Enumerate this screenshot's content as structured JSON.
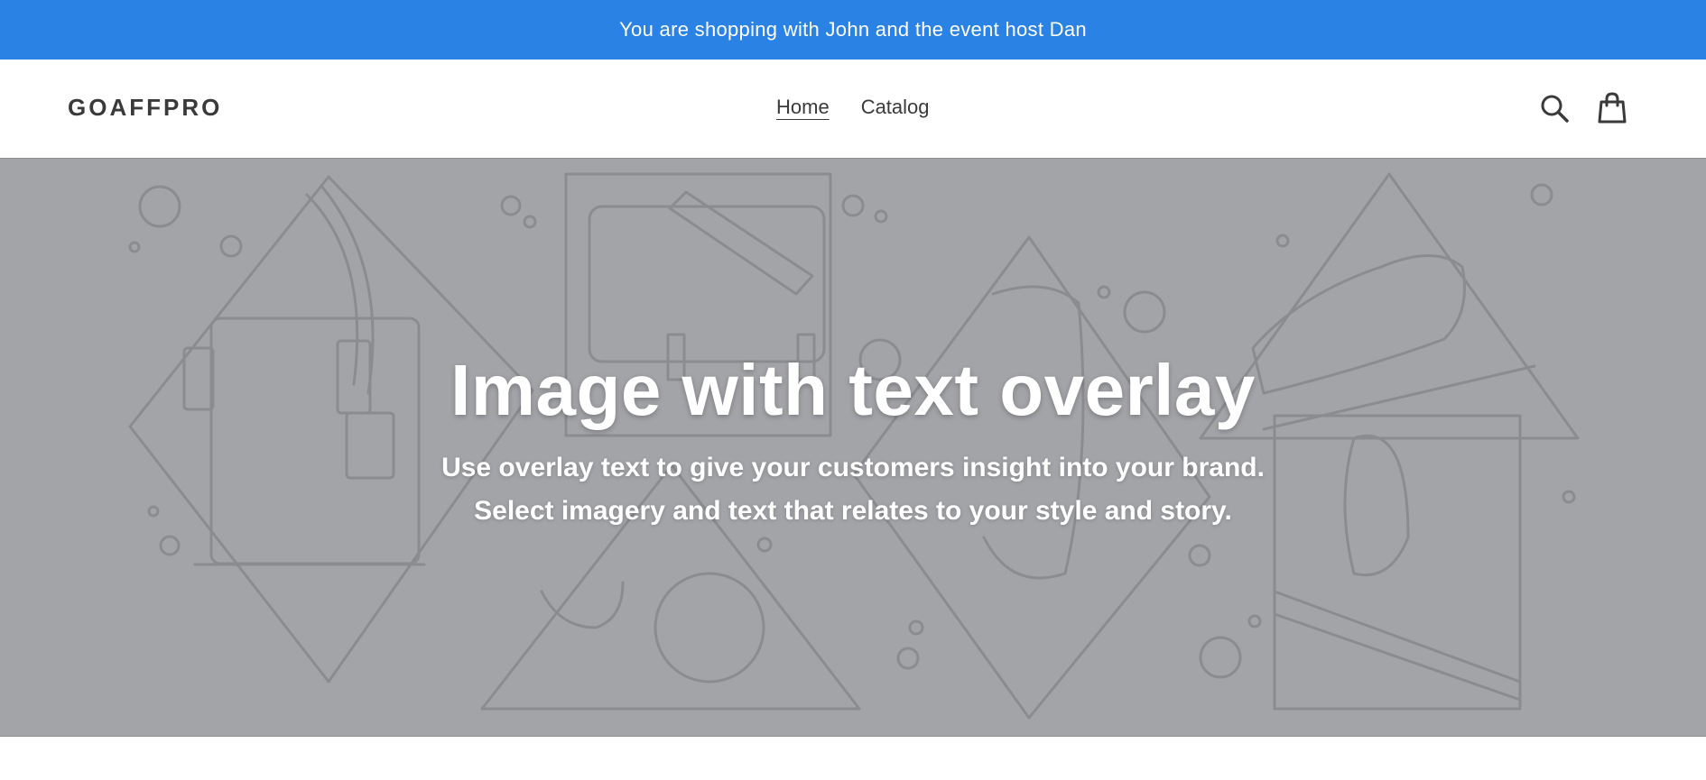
{
  "announcement": {
    "text": "You are shopping with John and the event host Dan",
    "background": "#2a82e4"
  },
  "header": {
    "logo": "GOAFFPRO",
    "nav": [
      {
        "label": "Home",
        "active": true
      },
      {
        "label": "Catalog",
        "active": false
      }
    ],
    "icons": [
      "search-icon",
      "cart-icon"
    ]
  },
  "hero": {
    "title": "Image with text overlay",
    "subtitle_line1": "Use overlay text to give your customers insight into your brand.",
    "subtitle_line2": "Select imagery and text that relates to your style and story.",
    "overlay_color": "#a3a4a8"
  }
}
